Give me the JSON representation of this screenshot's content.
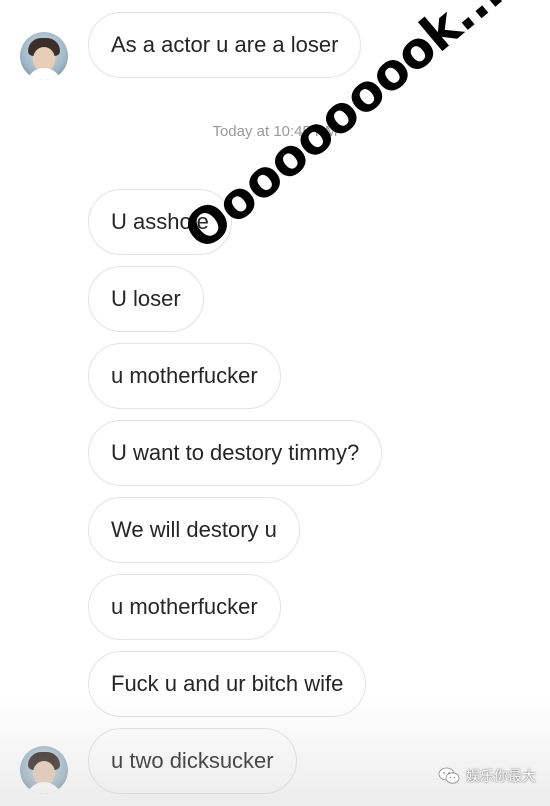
{
  "chat": {
    "first_message": "As a actor u are a loser",
    "timestamp": "Today at 10:45 PM",
    "messages": [
      "U asshole",
      "U loser",
      "u motherfucker",
      "U want to destory timmy?",
      "We will destory u",
      "u motherfucker",
      "Fuck u and ur bitch wife",
      "u two dicksucker"
    ]
  },
  "overlay": {
    "text": "Oooooooook....",
    "color": "#000000"
  },
  "watermark": {
    "text": "娱乐你最大",
    "icon": "wechat-icon"
  },
  "colors": {
    "bubble_border": "#e3e3e3",
    "text": "#262626",
    "timestamp": "#9a9a9a",
    "background": "#ffffff"
  }
}
